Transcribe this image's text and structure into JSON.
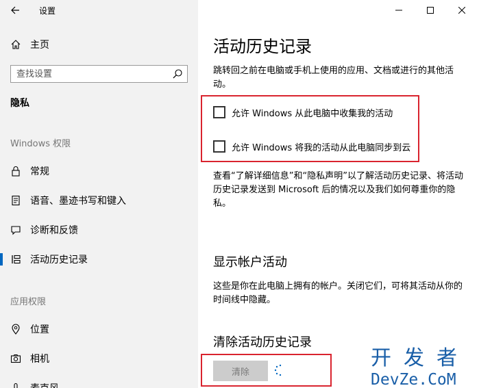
{
  "window": {
    "app_title": "设置",
    "back_icon": "arrow-left-icon"
  },
  "sidebar": {
    "home_label": "主页",
    "search_placeholder": "查找设置",
    "privacy_heading": "隐私",
    "windows_perms_heading": "Windows 权限",
    "app_perms_heading": "应用权限",
    "items": [
      {
        "label": "常规",
        "icon": "lock-icon"
      },
      {
        "label": "语音、墨迹书写和键入",
        "icon": "document-icon"
      },
      {
        "label": "诊断和反馈",
        "icon": "feedback-icon"
      },
      {
        "label": "活动历史记录",
        "icon": "timeline-icon",
        "active": true
      }
    ],
    "app_items": [
      {
        "label": "位置",
        "icon": "location-icon"
      },
      {
        "label": "相机",
        "icon": "camera-icon"
      },
      {
        "label": "麦克风",
        "icon": "microphone-icon"
      }
    ]
  },
  "main": {
    "title": "活动历史记录",
    "intro": "跳转回之前在电脑或手机上使用的应用、文档或进行的其他活动。",
    "checkbox1_label": "允许 Windows 从此电脑中收集我的活动",
    "checkbox1_checked": false,
    "checkbox2_label": "允许 Windows 将我的活动从此电脑同步到云",
    "checkbox2_checked": false,
    "privacy_note": "查看“了解详细信息”和“隐私声明”以了解活动历史记录、将活动历史记录发送到 Microsoft 后的情况以及我们如何尊重你的隐私。",
    "show_accounts_title": "显示帐户活动",
    "show_accounts_desc": "这些是你在此电脑上拥有的帐户。关闭它们，可将其活动从你的时间线中隐藏。",
    "clear_title": "清除活动历史记录",
    "clear_button": "清除"
  },
  "watermark": {
    "top": "开发者",
    "bottom": "DevZe.CoM"
  },
  "colors": {
    "accent": "#0067c0",
    "highlight_box": "#d9232e",
    "watermark": "#1a5fa8"
  }
}
